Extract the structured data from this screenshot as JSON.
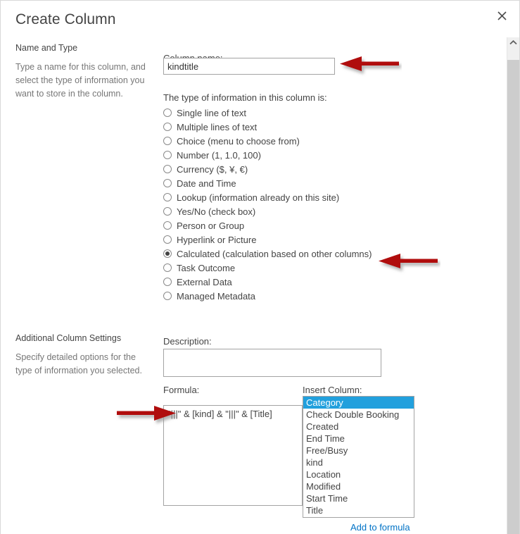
{
  "dialog": {
    "title": "Create Column",
    "close_icon": "close-icon"
  },
  "sections": {
    "name_and_type": {
      "heading": "Name and Type",
      "description": "Type a name for this column, and select the type of information you want to store in the column."
    },
    "additional_column_settings": {
      "heading": "Additional Column Settings",
      "description": "Specify detailed options for the type of information you selected."
    }
  },
  "fields": {
    "column_name": {
      "label": "Column name:",
      "value": "kindtitle",
      "placeholder": ""
    },
    "type_of_information": {
      "label": "The type of information in this column is:",
      "selected": "Calculated (calculation based on other columns)",
      "options": [
        "Single line of text",
        "Multiple lines of text",
        "Choice (menu to choose from)",
        "Number (1, 1.0, 100)",
        "Currency ($, ¥, €)",
        "Date and Time",
        "Lookup (information already on this site)",
        "Yes/No (check box)",
        "Person or Group",
        "Hyperlink or Picture",
        "Calculated (calculation based on other columns)",
        "Task Outcome",
        "External Data",
        "Managed Metadata"
      ]
    },
    "description": {
      "label": "Description:",
      "value": "",
      "placeholder": ""
    },
    "formula": {
      "label": "Formula:",
      "value": "\"|||\" & [kind] & \"|||\" & [Title]",
      "placeholder": ""
    },
    "insert_column": {
      "label": "Insert Column:",
      "selected": "Category",
      "options": [
        "Category",
        "Check Double Booking",
        "Created",
        "End Time",
        "Free/Busy",
        "kind",
        "Location",
        "Modified",
        "Start Time",
        "Title"
      ]
    },
    "add_to_formula": {
      "label": "Add to formula"
    }
  },
  "scrollbar": {
    "up_arrow_icon": "chevron-up-icon"
  },
  "annotations": {
    "arrow_color": "#b01010",
    "arrows": [
      {
        "name": "arrow-to-column-name",
        "direction": "left"
      },
      {
        "name": "arrow-to-calculated-option",
        "direction": "left"
      },
      {
        "name": "arrow-to-formula",
        "direction": "right"
      }
    ]
  },
  "colors": {
    "accent_link": "#0072c6",
    "list_selection": "#22a0dd",
    "text": "#444444",
    "muted_text": "#777777",
    "border": "#a3a3a3"
  }
}
